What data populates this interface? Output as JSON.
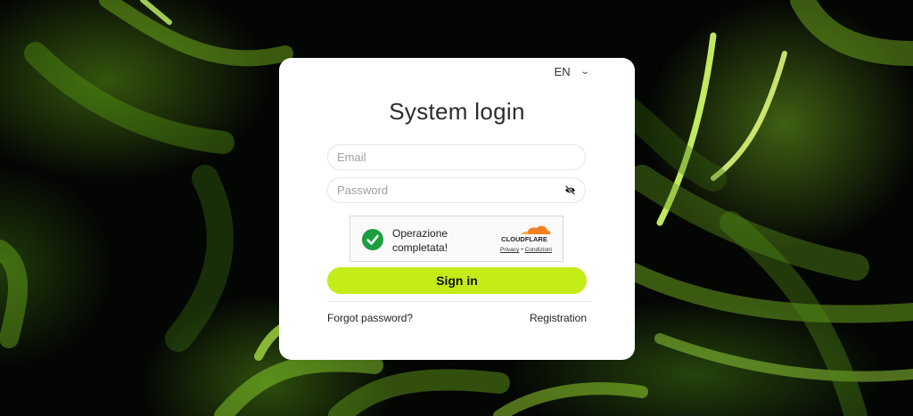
{
  "language": {
    "selected": "EN"
  },
  "login": {
    "title": "System login",
    "email_placeholder": "Email",
    "password_placeholder": "Password",
    "signin_label": "Sign in",
    "forgot_label": "Forgot password?",
    "register_label": "Registration"
  },
  "captcha": {
    "status_text": "Operazione completata!",
    "brand": "CLOUDFLARE",
    "privacy_label": "Privacy",
    "separator": "•",
    "terms_label": "Condizioni"
  },
  "colors": {
    "accent": "#c3ec19",
    "success": "#1a9e3f",
    "cloudflare_orange": "#f48120"
  },
  "icons": {
    "language_toggle": "chevron-down-icon",
    "password_toggle": "eye-slash-icon",
    "captcha_status": "checkmark-icon",
    "brand_logo": "cloudflare-logo"
  }
}
